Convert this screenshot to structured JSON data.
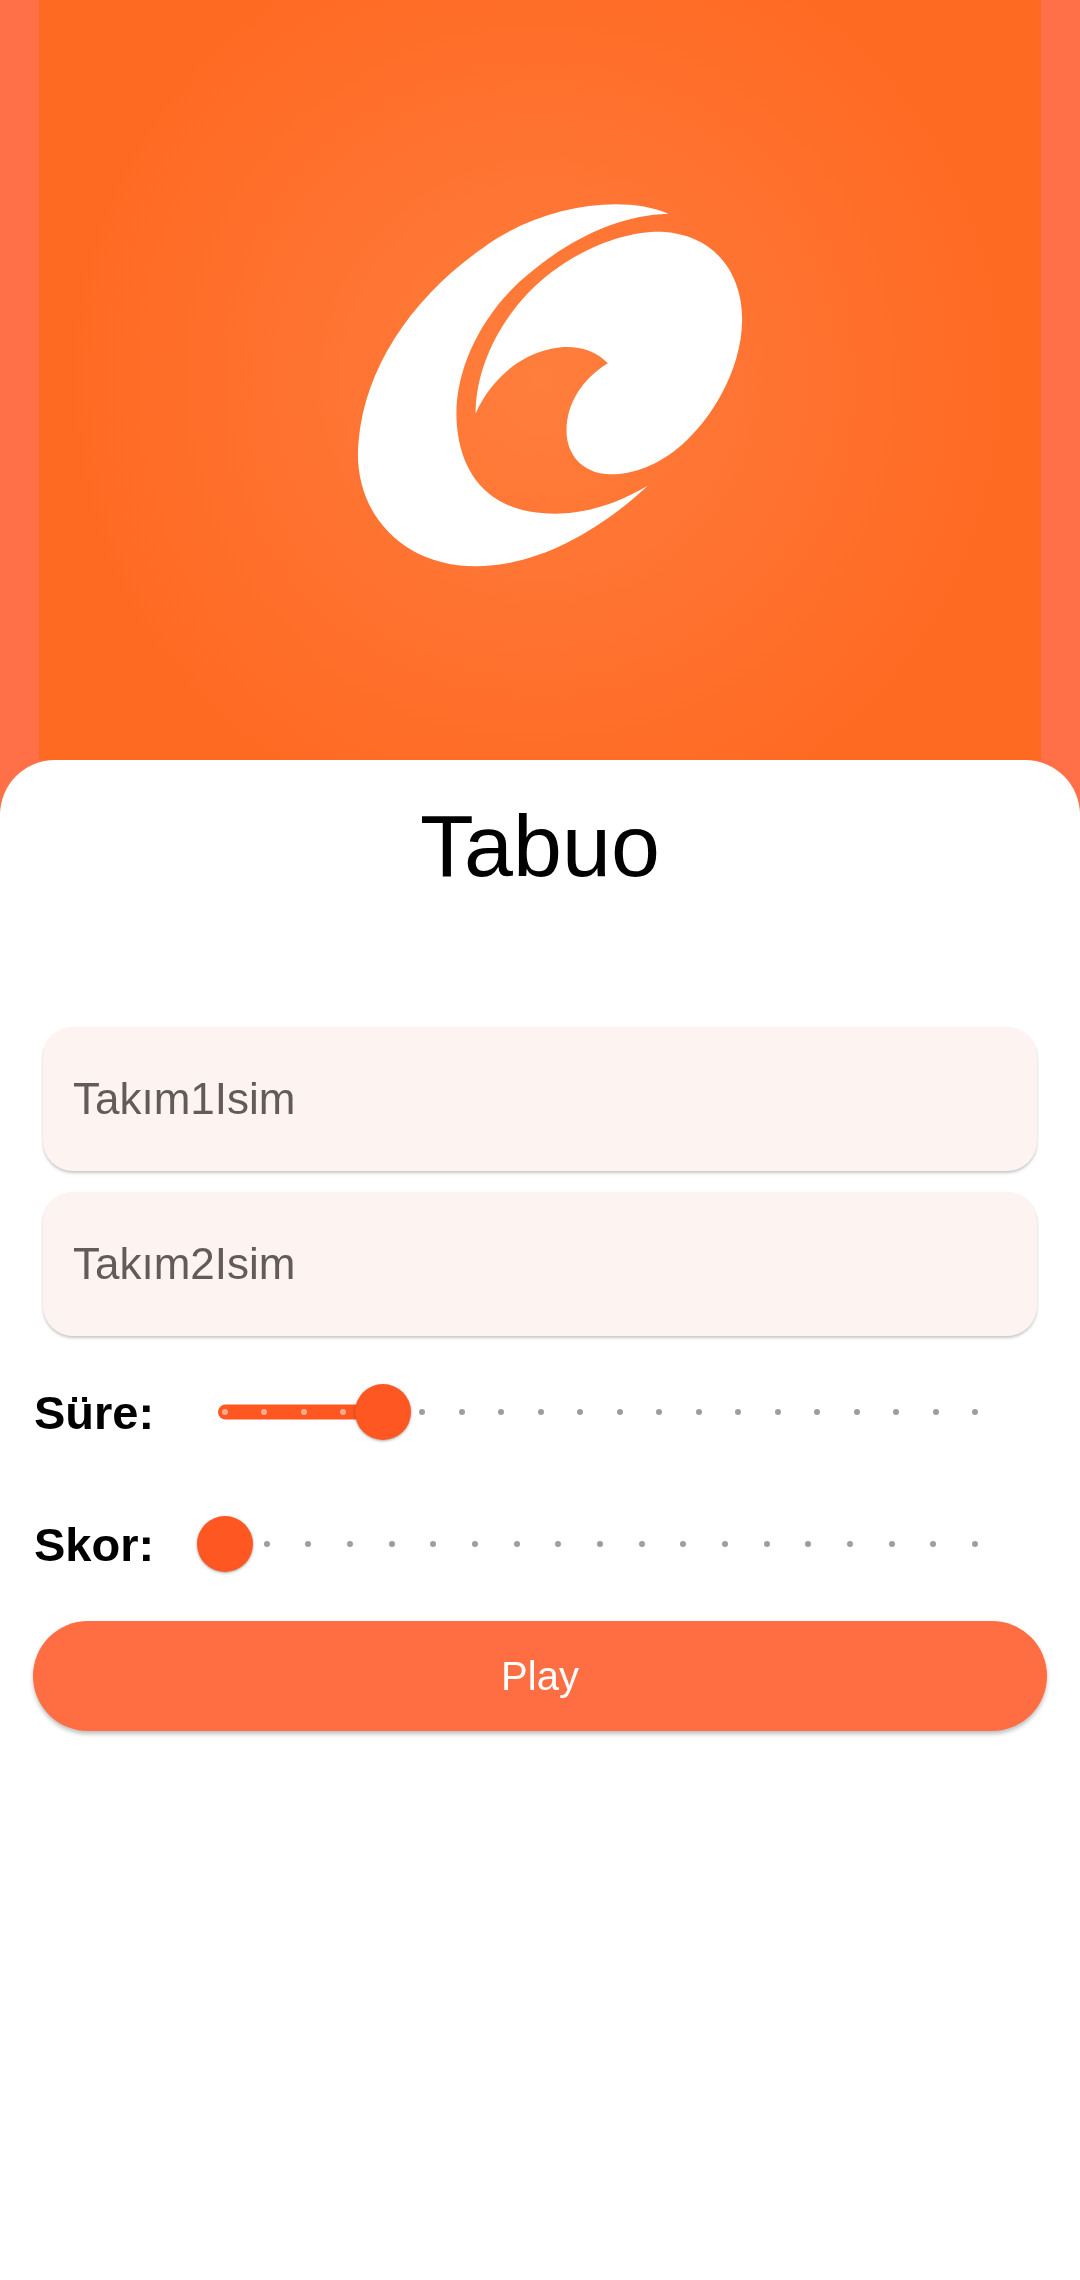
{
  "title": "Tabuo",
  "fields": [
    {
      "placeholder": "Takım1Isim"
    },
    {
      "placeholder": "Takım2Isim"
    }
  ],
  "sliders": [
    {
      "label": "Süre:",
      "level": 0.21
    },
    {
      "label": "Skor:",
      "level": 0
    }
  ],
  "play_button": {
    "label": "Play"
  }
}
